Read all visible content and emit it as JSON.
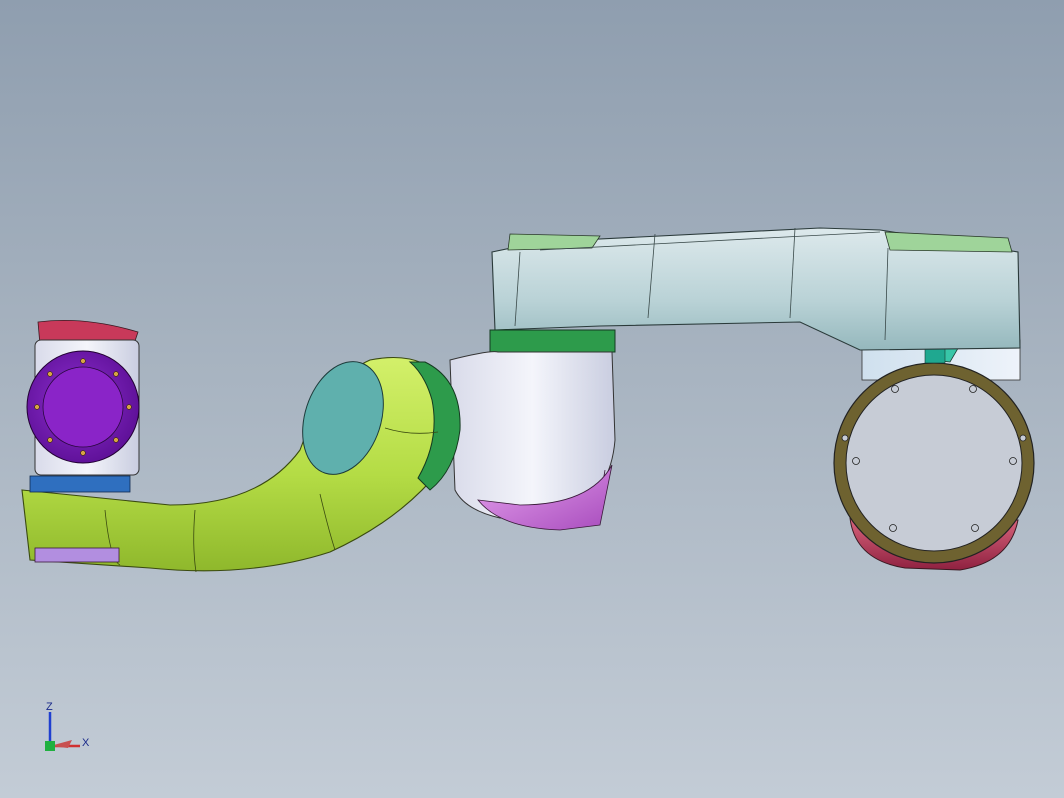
{
  "viewport": {
    "description_visible": false,
    "triad": {
      "z_label": "Z",
      "x_label": "X"
    }
  },
  "colors": {
    "background_top": "#8f9eaf",
    "background_bottom": "#c3ccd6",
    "lime": "#b8e04a",
    "lime_dark": "#6f8f1a",
    "teal_panel": "#5fb0ad",
    "white_body": "#eef0f6",
    "pale_blue": "#cfe2ea",
    "purple_flange": "#7b1fb8",
    "magenta": "#c66bd6",
    "crimson": "#b23a55",
    "green_ring": "#2d9b4b",
    "blue_ring": "#2f6fbf",
    "brown_ring": "#6e6230"
  }
}
